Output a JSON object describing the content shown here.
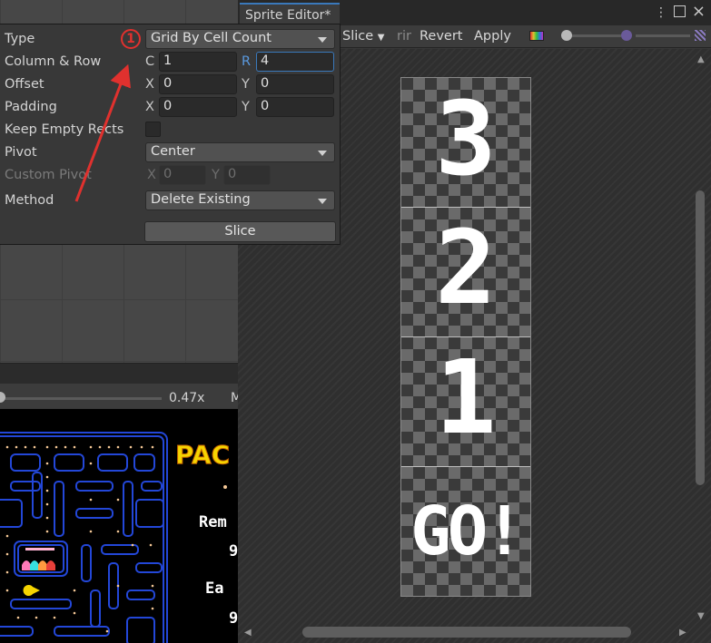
{
  "sprite_editor": {
    "tab_title": "Sprite Editor*",
    "toolbar": {
      "slice_menu": "Slice",
      "trim_label": "rir",
      "revert_label": "Revert",
      "apply_label": "Apply"
    },
    "sheet_frames": [
      "3",
      "2",
      "1",
      "GO!"
    ]
  },
  "slice_panel": {
    "type_label": "Type",
    "type_value": "Grid By Cell Count",
    "column_row_label": "Column & Row",
    "column_axis": "C",
    "column_value": "1",
    "row_axis": "R",
    "row_value": "4",
    "offset_label": "Offset",
    "offset_x_axis": "X",
    "offset_x": "0",
    "offset_y_axis": "Y",
    "offset_y": "0",
    "padding_label": "Padding",
    "padding_x_axis": "X",
    "padding_x": "0",
    "padding_y_axis": "Y",
    "padding_y": "0",
    "keep_empty_label": "Keep Empty Rects",
    "keep_empty_checked": false,
    "pivot_label": "Pivot",
    "pivot_value": "Center",
    "custom_pivot_label": "Custom Pivot",
    "custom_pivot_x_axis": "X",
    "custom_pivot_x": "0",
    "custom_pivot_y_axis": "Y",
    "custom_pivot_y": "0",
    "method_label": "Method",
    "method_value": "Delete Existing",
    "slice_button": "Slice"
  },
  "annotation": {
    "badge": "1",
    "color": "#e0312e"
  },
  "game_view": {
    "zoom_label": "0.47x",
    "maximize_label": "M",
    "title_fragment": "PAC",
    "hud": [
      "Rem",
      "9",
      "Ea",
      "9"
    ]
  },
  "colors": {
    "accent": "#3a79bb",
    "panel_bg": "#383838",
    "maze_blue": "#2347d8"
  }
}
